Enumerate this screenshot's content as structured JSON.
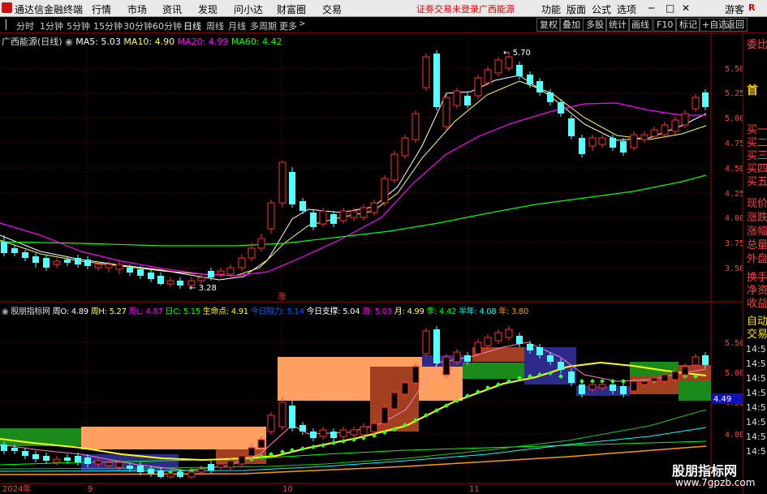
{
  "menu": {
    "title": "通达信金融终端",
    "items": [
      "行情",
      "市场",
      "资讯",
      "发现",
      "问小达",
      "财富圈",
      "交易"
    ],
    "warning": "证劵交易未登录",
    "stock_name_top": "广西能源",
    "right_items": [
      "功能",
      "版面",
      "公式",
      "选项"
    ],
    "guest": "游客"
  },
  "periods": {
    "items": [
      "分时",
      "1分钟",
      "5分钟",
      "15分钟",
      "30分钟",
      "60分钟",
      "日线",
      "周线",
      "月线",
      "多周期",
      "更多"
    ],
    "selected": "日线"
  },
  "toolbar": [
    "复权",
    "叠加",
    "多股",
    "统计",
    "画线",
    "F10",
    "标记",
    "+自选",
    "返回"
  ],
  "main_chart": {
    "title": "广西能源(日线)",
    "ma": [
      {
        "label": "MA5: 5.03",
        "color": "#ffffff"
      },
      {
        "label": "MA10: 4.90",
        "color": "#ffff66"
      },
      {
        "label": "MA20: 4.99",
        "color": "#ff00ff"
      },
      {
        "label": "MA60: 4.42",
        "color": "#00ff00"
      }
    ],
    "high_label": "5.70",
    "low_label": "3.28",
    "zhang_marker": "涨",
    "y_ticks": [
      "5.50",
      "5.25",
      "5.00",
      "4.75",
      "4.50",
      "4.25",
      "4.00",
      "3.75",
      "3.50"
    ]
  },
  "sub_chart": {
    "title": "股朋指标网",
    "fields": [
      {
        "label": "周O: 4.89",
        "color": "#ffffff"
      },
      {
        "label": "周H: 5.27",
        "color": "#ffff66"
      },
      {
        "label": "周L: 4.87",
        "color": "#ff00ff"
      },
      {
        "label": "日C: 5.15",
        "color": "#00ff00"
      },
      {
        "label": "生命点: 4.91",
        "color": "#ffff00"
      },
      {
        "label": "今日阻力: 5.14",
        "color": "#0060ff"
      },
      {
        "label": "今日支撑: 5.04",
        "color": "#ffffff"
      },
      {
        "label": "周: 5.03",
        "color": "#ff00ff"
      },
      {
        "label": "月: 4.99",
        "color": "#ffff66"
      },
      {
        "label": "季: 4.42",
        "color": "#00ff00"
      },
      {
        "label": "半年: 4.08",
        "color": "#00ffff"
      },
      {
        "label": "年: 3.80",
        "color": "#ff9900"
      }
    ],
    "y_ticks": [
      "5.50",
      "5.00",
      "4.50",
      "4.00"
    ],
    "current_price": "4.49"
  },
  "x_axis": [
    "2024年",
    "9",
    "10",
    "11"
  ],
  "right_panel": {
    "top": [
      "委比",
      "首",
      "买一",
      "买二",
      "买三",
      "买四",
      "买五",
      "现价",
      "涨跌",
      "涨幅",
      "总量",
      "外盘",
      "换手",
      "净资",
      "收益"
    ],
    "bottom": [
      "自动",
      "交易",
      "14:5",
      "14:5",
      "14:5",
      "14:5",
      "14:5",
      "14:5",
      "14:5",
      "14:5"
    ]
  },
  "watermark": {
    "line1": "股朋指标网",
    "line2": "www.7gpzb.com"
  }
}
